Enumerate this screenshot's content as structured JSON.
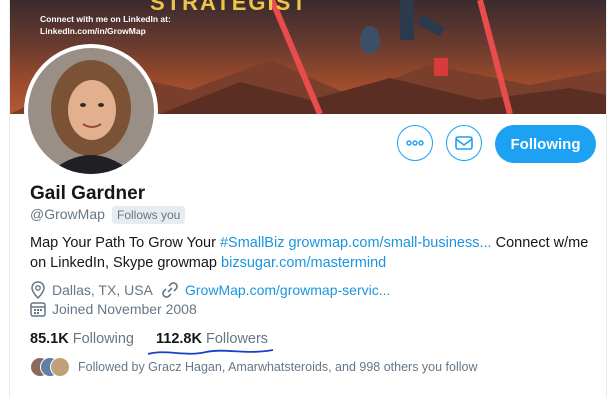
{
  "banner": {
    "headline": "STRATEGIST",
    "line1": "Connect with me on LinkedIn at:",
    "line2": "LinkedIn.com/in/GrowMap"
  },
  "profile": {
    "name": "Gail Gardner",
    "handle": "@GrowMap",
    "follows_you": "Follows you",
    "bio": {
      "part1": "Map Your Path To Grow Your ",
      "hashtag": "#SmallBiz",
      "link1": "growmap.com/small-business...",
      "part2": " Connect w/me on LinkedIn, Skype growmap ",
      "link2": "bizsugar.com/mastermind"
    },
    "location": "Dallas, TX, USA",
    "website": "GrowMap.com/growmap-servic...",
    "joined": "Joined November 2008"
  },
  "actions": {
    "following_label": "Following",
    "more_icon": "more-icon",
    "message_icon": "envelope-icon"
  },
  "stats": {
    "following_count": "85.1K",
    "following_label": "Following",
    "followers_count": "112.8K",
    "followers_label": "Followers"
  },
  "followed_by": "Followed by Gracz Hagan, Amarwhatsteroids, and 998 others you follow",
  "colors": {
    "accent": "#1da1f2",
    "link": "#1b95e0",
    "muted": "#657786",
    "annotation": "#1a3fc9"
  }
}
